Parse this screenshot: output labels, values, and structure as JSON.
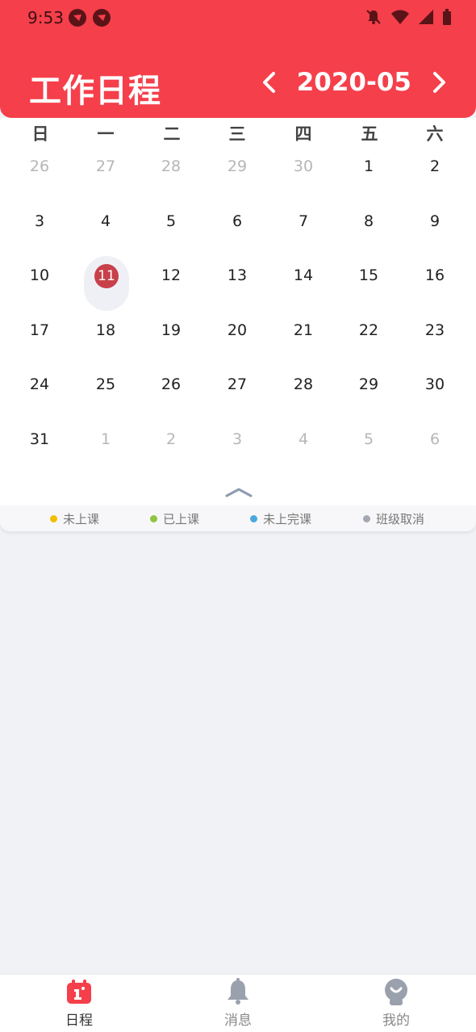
{
  "status_bar": {
    "time": "9:53"
  },
  "header": {
    "title": "工作日程",
    "month": "2020-05",
    "bg_color": "#f53f4b"
  },
  "calendar": {
    "weekdays": [
      "日",
      "一",
      "二",
      "三",
      "四",
      "五",
      "六"
    ],
    "weeks": [
      [
        "26",
        "27",
        "28",
        "29",
        "30",
        "1",
        "2"
      ],
      [
        "3",
        "4",
        "5",
        "6",
        "7",
        "8",
        "9"
      ],
      [
        "10",
        "11",
        "12",
        "13",
        "14",
        "15",
        "16"
      ],
      [
        "17",
        "18",
        "19",
        "20",
        "21",
        "22",
        "23"
      ],
      [
        "24",
        "25",
        "26",
        "27",
        "28",
        "29",
        "30"
      ],
      [
        "31",
        "1",
        "2",
        "3",
        "4",
        "5",
        "6"
      ]
    ],
    "selected_day": "11",
    "selected_color": "#c8404a"
  },
  "legend": [
    {
      "label": "未上课",
      "color": "#f3bd00"
    },
    {
      "label": "已上课",
      "color": "#8cc63f"
    },
    {
      "label": "未上完课",
      "color": "#4aa8de"
    },
    {
      "label": "班级取消",
      "color": "#a4a8b2"
    }
  ],
  "tabbar": {
    "tabs": [
      {
        "label": "日程",
        "icon": "calendar-icon",
        "active": true
      },
      {
        "label": "消息",
        "icon": "bell-icon",
        "active": false
      },
      {
        "label": "我的",
        "icon": "profile-icon",
        "active": false
      }
    ]
  }
}
